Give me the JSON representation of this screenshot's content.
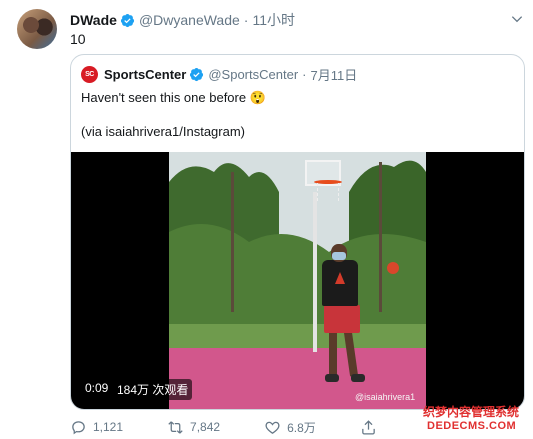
{
  "tweet": {
    "author_name": "DWade",
    "author_handle": "@DwyaneWade",
    "separator": "·",
    "time": "11小时",
    "text": "10"
  },
  "quoted": {
    "author_name": "SportsCenter",
    "author_handle": "@SportsCenter",
    "separator": "·",
    "date": "7月11日",
    "text_line1": "Haven't seen this one before 😲",
    "text_line2": "(via isaiahrivera1/Instagram)",
    "avatar_text": "SC"
  },
  "video": {
    "duration": "0:09",
    "views": "184万 次观看",
    "watermark": "@isaiahrivera1"
  },
  "actions": {
    "replies": "1,121",
    "retweets": "7,842",
    "likes": "6.8万"
  },
  "site_watermark": {
    "line1": "织梦内容管理系统",
    "line2": "DEDECMS.COM"
  },
  "colors": {
    "verified": "#1da1f2",
    "secondary_text": "#657786",
    "border": "#ccd6dd",
    "brand_red": "#d81b24"
  }
}
